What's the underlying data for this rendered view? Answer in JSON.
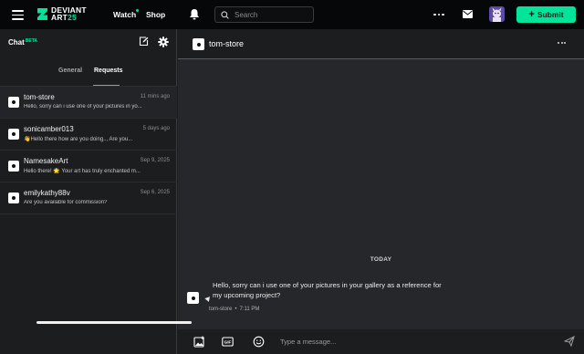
{
  "topbar": {
    "logo_line1": "DEVIANT",
    "logo_line2_a": "ART",
    "logo_line2_b": "25",
    "watch_label": "Watch",
    "shop_label": "Shop",
    "search_placeholder": "Search",
    "submit_label": "Submit",
    "accent_color": "#00e59b"
  },
  "sidebar": {
    "title": "Chat",
    "beta": "BETA",
    "tabs": [
      {
        "label": "General",
        "active": false
      },
      {
        "label": "Requests",
        "active": true
      }
    ],
    "conversations": [
      {
        "name": "tom-store",
        "time": "11 mins ago",
        "preview": "Hello, sorry can i use one of your pictures in yo..."
      },
      {
        "name": "sonicamber013",
        "time": "5 days ago",
        "preview": "👋Hello there how are you doing.., Are you..."
      },
      {
        "name": "NamesakeArt",
        "time": "Sep 9, 2025",
        "preview": "Hello there! 🌟 Your art has truly enchanted m..."
      },
      {
        "name": "emilykathy88v",
        "time": "Sep 6, 2025",
        "preview": "Are you available for commission?"
      }
    ]
  },
  "main": {
    "header_name": "tom-store",
    "date_separator": "TODAY",
    "message": {
      "text": "Hello, sorry can i use one of your pictures in your gallery as a reference for my upcoming project?",
      "author": "tom-store",
      "time": "7:11 PM"
    },
    "composer_placeholder": "Type a message..."
  }
}
